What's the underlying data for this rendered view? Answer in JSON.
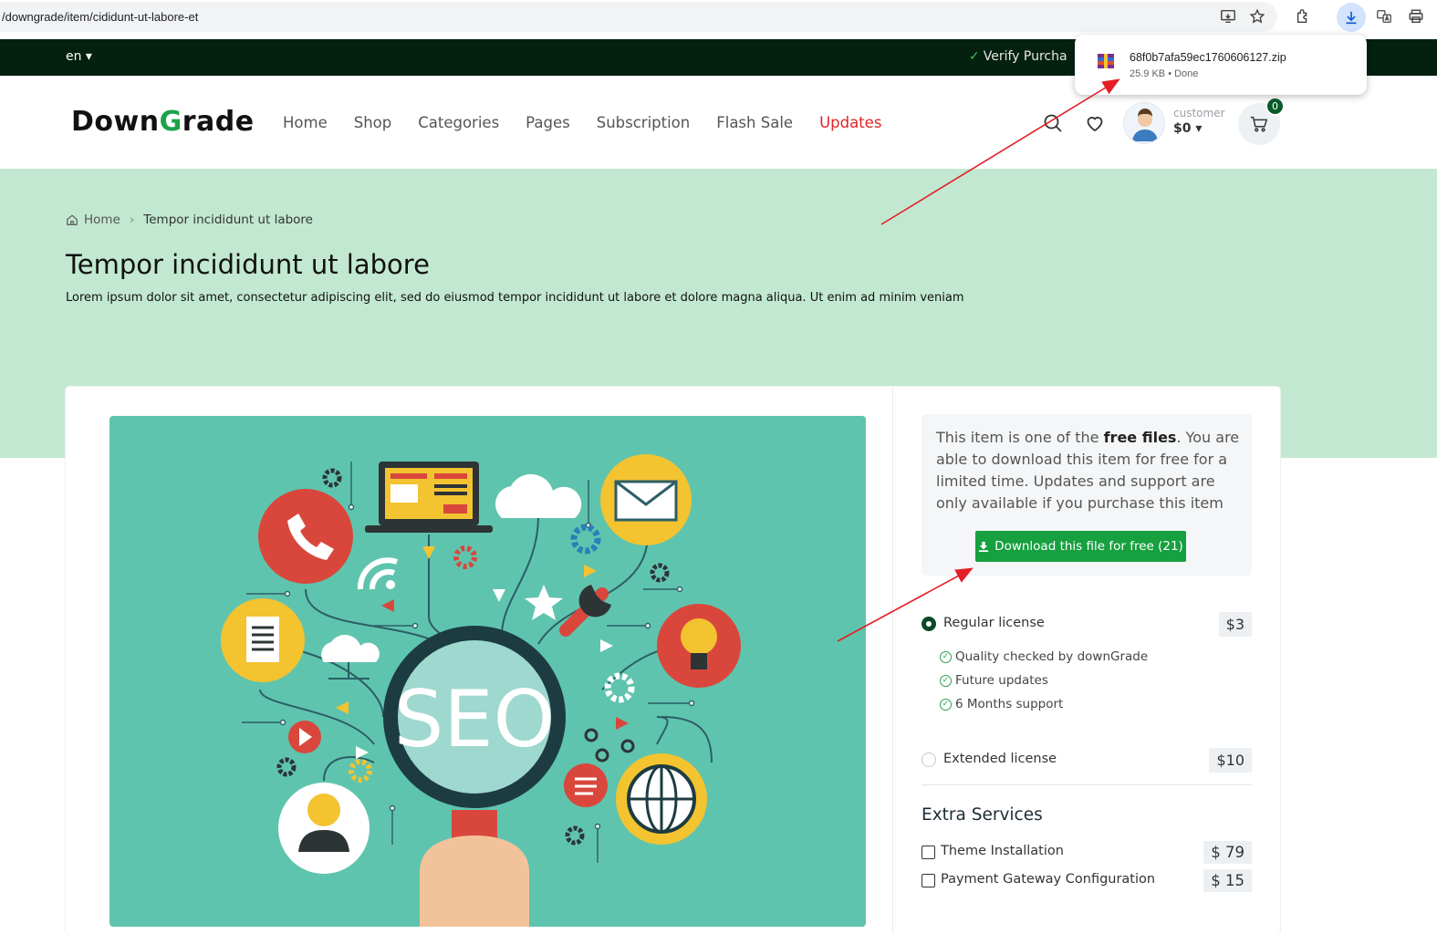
{
  "browser": {
    "url": "/downgrade/item/cididunt-ut-labore-et",
    "download": {
      "filename": "68f0b7afa59ec1760606127.zip",
      "meta": "25.9 KB • Done"
    }
  },
  "topbar": {
    "language": "en ▾",
    "verify_text": "Verify Purcha"
  },
  "header": {
    "logo_prefix": "Down",
    "logo_g": "G",
    "logo_suffix": "rade",
    "nav": [
      "Home",
      "Shop",
      "Categories",
      "Pages",
      "Subscription",
      "Flash Sale",
      "Updates"
    ],
    "customer_label": "customer",
    "balance": "$0 ▾",
    "cart_count": "0"
  },
  "hero": {
    "breadcrumb_home": "Home",
    "breadcrumb_current": "Tempor incididunt ut labore",
    "title": "Tempor incididunt ut labore",
    "description": "Lorem ipsum dolor sit amet, consectetur adipiscing elit, sed do eiusmod tempor incididunt ut labore et dolore magna aliqua. Ut enim ad minim veniam"
  },
  "product": {
    "image_text": "SEO"
  },
  "sidebar": {
    "free_text_before": "This item is one of the ",
    "free_text_bold": "free files",
    "free_text_after": ". You are able to download this item for free for a limited time. Updates and support are only available if you purchase this item",
    "download_button": "Download this file for free (21)",
    "licenses": [
      {
        "label": "Regular license",
        "price": "$3",
        "selected": true
      },
      {
        "label": "Extended license",
        "price": "$10",
        "selected": false
      }
    ],
    "features": [
      "Quality checked by downGrade",
      "Future updates",
      "6 Months support"
    ],
    "extra_title": "Extra Services",
    "services": [
      {
        "label": "Theme Installation",
        "price": "$ 79"
      },
      {
        "label": "Payment Gateway Configuration",
        "price": "$ 15"
      }
    ]
  },
  "colors": {
    "brand_green": "#1aa34a",
    "dark_strip": "#04200f",
    "hero_bg": "#c2e8d1",
    "button_green": "#16a03f",
    "updates_red": "#e02424",
    "annotation_red": "#e41e26"
  }
}
